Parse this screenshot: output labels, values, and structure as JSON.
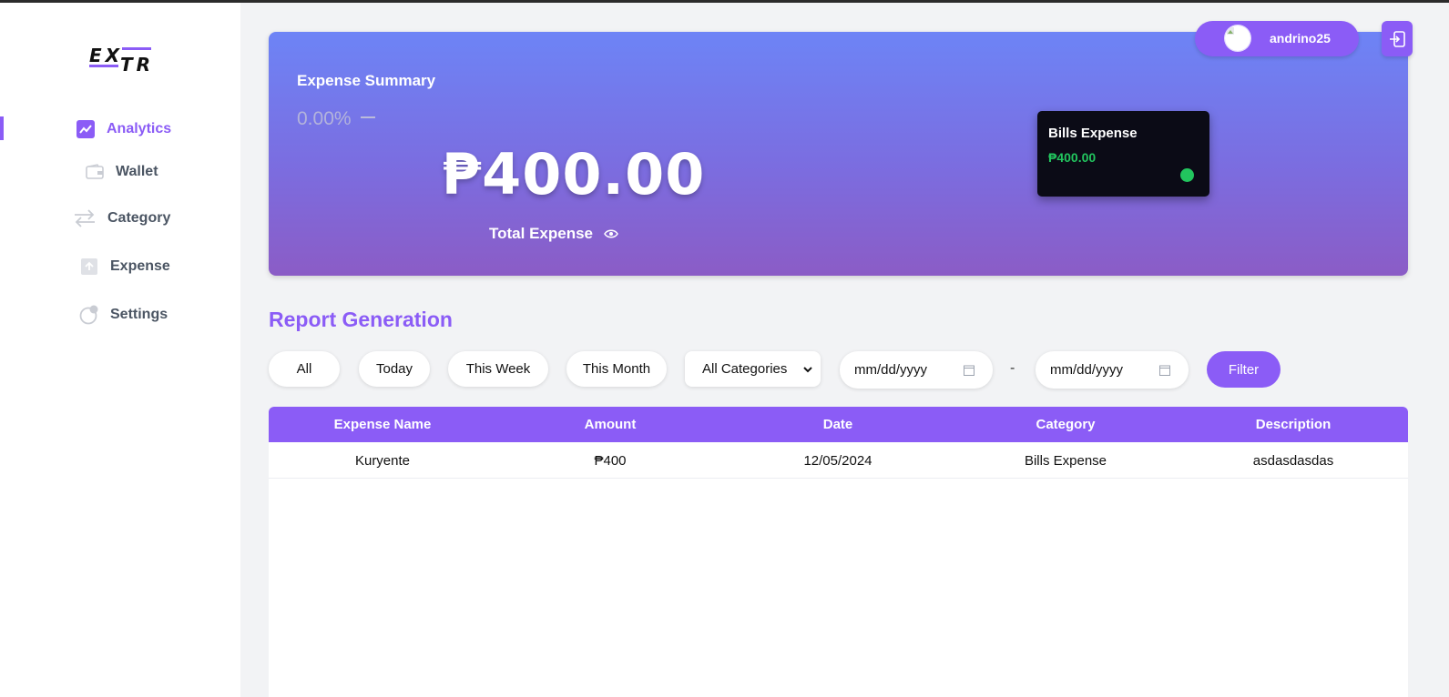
{
  "app": {
    "logo_top": "EX",
    "logo_bottom": "TR"
  },
  "sidebar": {
    "items": [
      {
        "label": "Analytics",
        "icon": "chart-line-icon",
        "active": true
      },
      {
        "label": "Wallet",
        "icon": "wallet-icon",
        "active": false
      },
      {
        "label": "Category",
        "icon": "arrows-swap-icon",
        "active": false
      },
      {
        "label": "Expense",
        "icon": "upload-icon",
        "active": false
      },
      {
        "label": "Settings",
        "icon": "settings-icon",
        "active": false
      }
    ]
  },
  "user": {
    "username": "andrino25"
  },
  "summary": {
    "title": "Expense Summary",
    "percent": "0.00%",
    "total": "₱400.00",
    "total_label": "Total Expense",
    "category_card": {
      "title": "Bills Expense",
      "amount": "₱400.00",
      "dot_color": "#22c55e"
    }
  },
  "report": {
    "title": "Report Generation",
    "filters": {
      "all": "All",
      "today": "Today",
      "this_week": "This Week",
      "this_month": "This Month",
      "category_selected": "All Categories",
      "date_from_placeholder": "mm/dd/yyyy",
      "date_to_placeholder": "mm/dd/yyyy",
      "range_separator": "-",
      "filter_button": "Filter"
    },
    "table": {
      "headers": [
        "Expense Name",
        "Amount",
        "Date",
        "Category",
        "Description"
      ],
      "rows": [
        [
          "Kuryente",
          "₱400",
          "12/05/2024",
          "Bills Expense",
          "asdasdasdas"
        ]
      ]
    }
  },
  "colors": {
    "accent": "#8b5cf6",
    "positive": "#22c55e"
  }
}
